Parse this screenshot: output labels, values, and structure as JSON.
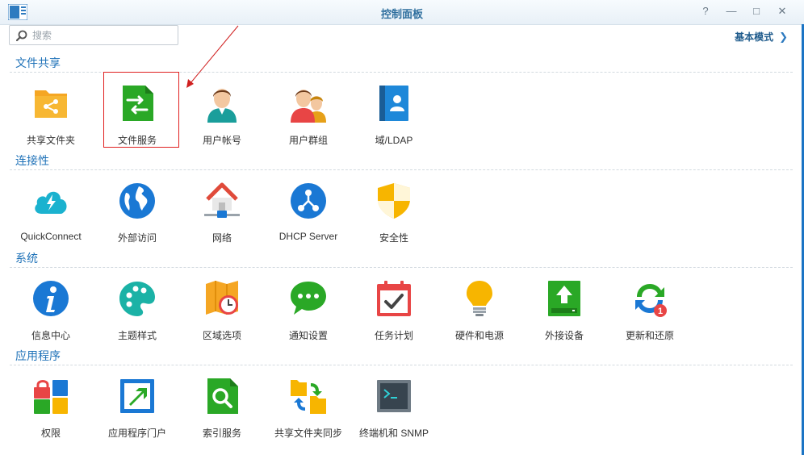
{
  "window": {
    "title": "控制面板",
    "help": "?",
    "minimize": "—",
    "maximize": "□",
    "close": "✕"
  },
  "search": {
    "placeholder": "搜索",
    "value": ""
  },
  "mode_toggle": {
    "label": "基本模式",
    "chevron": "❯"
  },
  "sections": [
    {
      "title": "文件共享",
      "items": [
        {
          "label": "共享文件夹",
          "icon": "shared-folder-icon"
        },
        {
          "label": "文件服务",
          "icon": "file-services-icon",
          "highlighted": true
        },
        {
          "label": "用户帐号",
          "icon": "user-icon"
        },
        {
          "label": "用户群组",
          "icon": "group-icon"
        },
        {
          "label": "域/LDAP",
          "icon": "ldap-icon"
        }
      ]
    },
    {
      "title": "连接性",
      "items": [
        {
          "label": "QuickConnect",
          "icon": "quickconnect-icon"
        },
        {
          "label": "外部访问",
          "icon": "external-access-icon"
        },
        {
          "label": "网络",
          "icon": "network-icon"
        },
        {
          "label": "DHCP Server",
          "icon": "dhcp-icon"
        },
        {
          "label": "安全性",
          "icon": "security-shield-icon"
        }
      ]
    },
    {
      "title": "系统",
      "items": [
        {
          "label": "信息中心",
          "icon": "info-icon"
        },
        {
          "label": "主题样式",
          "icon": "palette-icon"
        },
        {
          "label": "区域选项",
          "icon": "regional-clock-icon"
        },
        {
          "label": "通知设置",
          "icon": "notification-chat-icon"
        },
        {
          "label": "任务计划",
          "icon": "task-calendar-icon"
        },
        {
          "label": "硬件和电源",
          "icon": "lightbulb-icon"
        },
        {
          "label": "外接设备",
          "icon": "external-device-icon"
        },
        {
          "label": "更新和还原",
          "icon": "update-restore-icon",
          "badge": "1"
        }
      ]
    },
    {
      "title": "应用程序",
      "items": [
        {
          "label": "权限",
          "icon": "privileges-icon"
        },
        {
          "label": "应用程序门户",
          "icon": "app-portal-icon"
        },
        {
          "label": "索引服务",
          "icon": "index-search-icon"
        },
        {
          "label": "共享文件夹同步",
          "icon": "folder-sync-icon"
        },
        {
          "label": "终端机和 SNMP",
          "icon": "terminal-icon"
        }
      ]
    }
  ],
  "colors": {
    "accent": "#1f72b8",
    "highlight_box": "#e02020",
    "arrow": "#d02020"
  }
}
